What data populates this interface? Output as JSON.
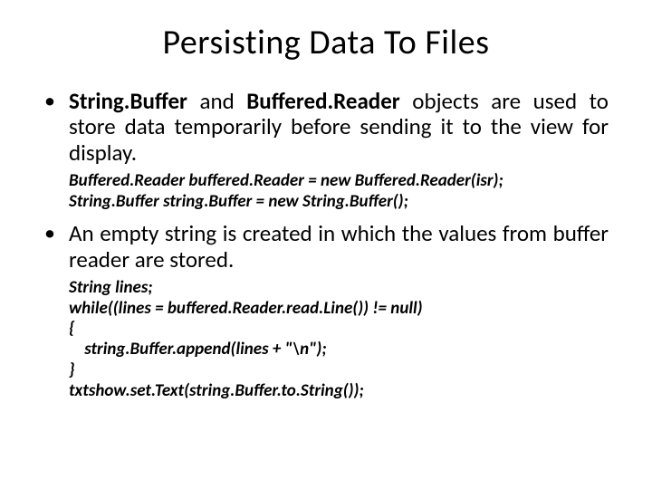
{
  "title": "Persisting Data To Files",
  "bullets": [
    {
      "prefix_bold_1": "String.Buffer",
      "mid_1": " and ",
      "prefix_bold_2": "Buffered.Reader",
      "text_rest": " objects are used to store data temporarily before sending it to the view for display."
    },
    {
      "text": "An empty string is created in which the values from buffer reader are stored."
    }
  ],
  "code1": "Buffered.Reader buffered.Reader = new Buffered.Reader(isr);\nString.Buffer string.Buffer = new String.Buffer();",
  "code2": "String lines;\nwhile((lines = buffered.Reader.read.Line()) != null)\n{\n    string.Buffer.append(lines + \"\\n\");\n}\ntxtshow.set.Text(string.Buffer.to.String());"
}
